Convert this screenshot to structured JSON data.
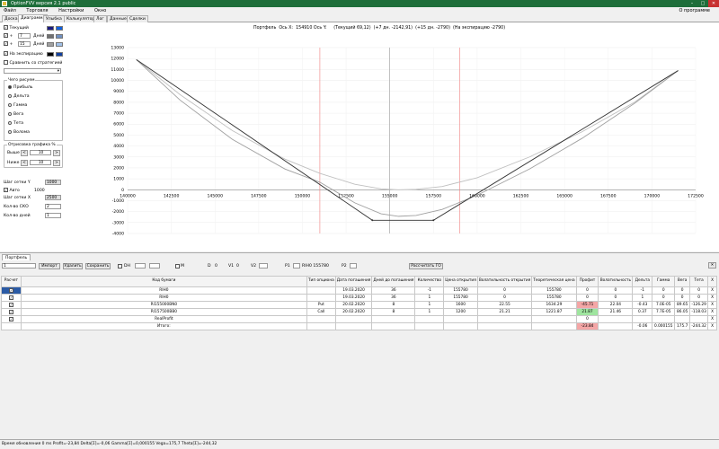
{
  "window": {
    "title": "OptionFVV версия 2.1 public",
    "min": "–",
    "max": "□",
    "close": "✕"
  },
  "menu": {
    "items": [
      "Файл",
      "Торговля",
      "Настройки",
      "Окно"
    ],
    "right": "О программе"
  },
  "tabs": [
    "Доска",
    "Диаграмма",
    "Улыбка",
    "Калькулятор",
    "Лог",
    "Данные",
    "Сделки"
  ],
  "left": {
    "current": "Текущий",
    "plus1": "+",
    "days1": "7",
    "days_label": "Дней",
    "plus2": "+",
    "days2": "15",
    "expiry": "На экспирацию",
    "compare": "Сравнить со стратегией",
    "what_title": "Чего рисуем",
    "what": [
      "Прибыль",
      "Дельта",
      "Гамма",
      "Вега",
      "Тета",
      "Волома"
    ],
    "range_title": "Отрисовка графика %",
    "above": "Выше",
    "above_val": "10",
    "below": "Ниже",
    "below_val": "10",
    "minus": "<",
    "plus": ">",
    "gridY": "Шаг сетки Y",
    "gridY_val": "1000",
    "auto": "Авто",
    "auto_val": "1000",
    "gridX": "Шаг сетки X",
    "gridX_val": "2500",
    "sko": "Кол-во СКО",
    "sko_val": "2",
    "daysCount": "Кол-во дней",
    "daysCount_val": "1"
  },
  "colors": {
    "current": "#1a1a80",
    "current2": "#1060e0",
    "d1a": "#707070",
    "d1b": "#7090c0",
    "d2a": "#a0a0a0",
    "d2b": "#a0c0e8",
    "exp1": "#000000",
    "exp2": "#1040a0"
  },
  "chart_title": "Портфель  Ось X:  154910 Ось Y:     (Текущий 69,12)  (+7 дн. -2142,91)  (+15 дн. -2790)  (На экспирацию -2790)",
  "chart_data": {
    "type": "line",
    "xlim": [
      140000,
      172500
    ],
    "ylim": [
      -4000,
      13000
    ],
    "xticks": [
      140000,
      142500,
      145000,
      147500,
      150000,
      152500,
      155000,
      157500,
      160000,
      162500,
      165000,
      167500,
      170000,
      172500
    ],
    "yticks": [
      -4000,
      -3000,
      -2000,
      -1000,
      0,
      1000,
      2000,
      3000,
      4000,
      5000,
      6000,
      7000,
      8000,
      9000,
      10000,
      11000,
      12000,
      13000
    ],
    "vlines_red": [
      151000,
      159000
    ],
    "vline_gray": 155000,
    "series": [
      {
        "color": "#333333",
        "x": [
          140500,
          154000,
          157500,
          171500
        ],
        "y": [
          11900,
          -2790,
          -2790,
          10900
        ]
      },
      {
        "color": "#a0a0a0",
        "x": [
          140500,
          143000,
          146000,
          149000,
          151000,
          153000,
          154500,
          155500,
          156500,
          158000,
          160000,
          163000,
          166000,
          169000,
          171500
        ],
        "y": [
          11900,
          8200,
          4600,
          1900,
          690,
          -1200,
          -2200,
          -2430,
          -2350,
          -1800,
          -500,
          1900,
          4700,
          7900,
          10900
        ]
      },
      {
        "color": "#c0c0c0",
        "x": [
          140500,
          143000,
          146000,
          149000,
          151000,
          153000,
          154500,
          155500,
          156500,
          158000,
          160000,
          163000,
          166000,
          169000,
          171500
        ],
        "y": [
          11900,
          8700,
          5400,
          2800,
          1500,
          500,
          80,
          0,
          40,
          300,
          1100,
          3000,
          5300,
          8000,
          10900
        ]
      }
    ]
  },
  "portfolio": {
    "tab": "Портфель",
    "sel": "1",
    "import": "Импорт",
    "delete": "Удалить",
    "save": "Сохранить",
    "dh": "DH",
    "m": "M",
    "d": "D",
    "d_val": "0",
    "v1": "V1",
    "v1_val": "0",
    "v2": "V2",
    "p1": "P1",
    "p1_val": "RIH0 155780",
    "p2": "P2",
    "calc": "Рассчитать ГО"
  },
  "table": {
    "headers": [
      "Расчет",
      "Код бумаги",
      "Тип опциона",
      "Дата погашения",
      "Дней до погашения",
      "Количество",
      "Цена открытия",
      "Волатильность открытия",
      "Теоретическая цена",
      "Профит",
      "Волатильность",
      "Дельта",
      "Гамма",
      "Вега",
      "Тета",
      "X"
    ],
    "rows": [
      [
        "",
        "RIH0",
        "",
        "19.03.2020",
        "36",
        "-1",
        "155780",
        "0",
        "155780",
        "0",
        "0",
        "-1",
        "0",
        "0",
        "0",
        "X"
      ],
      [
        "",
        "RIH0",
        "",
        "19.03.2020",
        "36",
        "1",
        "155780",
        "0",
        "155780",
        "0",
        "0",
        "1",
        "0",
        "0",
        "0",
        "X"
      ],
      [
        "",
        "RI155000BN0",
        "Put",
        "20.02.2020",
        "8",
        "1",
        "1600",
        "22.55",
        "1634.29",
        "-45.71",
        "22.04",
        "-0.43",
        "7.0E-05",
        "89.65",
        "-126.29",
        "X"
      ],
      [
        "",
        "RI157500BB0",
        "Call",
        "20.02.2020",
        "8",
        "1",
        "1200",
        "21.21",
        "1221.87",
        "21.87",
        "21.46",
        "0.37",
        "7.7E-05",
        "86.05",
        "-118.03",
        "X"
      ],
      [
        "",
        "RealProfit",
        "",
        "",
        "",
        "",
        "",
        "",
        "",
        "0",
        "",
        "",
        "",
        "",
        "",
        "X"
      ],
      [
        "",
        "Итого:",
        "",
        "",
        "",
        "",
        "",
        "",
        "",
        "-23.84",
        "",
        "-0.06",
        "0.000155",
        "175.7",
        "-244.32",
        "X"
      ]
    ]
  },
  "status": "Время обновления 0 ms   Profit=-23,84 Delta[Σ]=-0,06 Gamma[Σ]=0,000155 Vega=175,7 Theta[Σ]=-244,32"
}
